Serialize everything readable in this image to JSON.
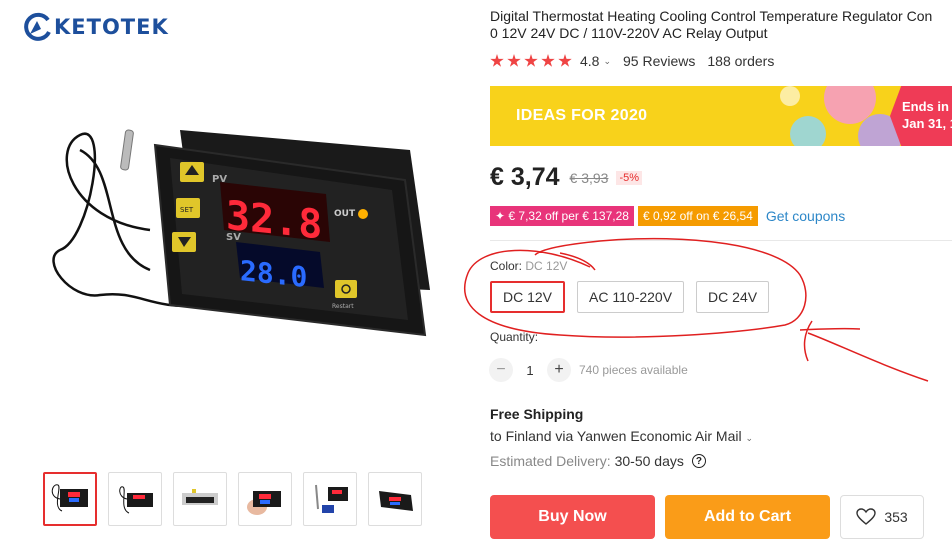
{
  "brand": {
    "logo_text": "KETOTEK"
  },
  "product": {
    "title_line1": "Digital Thermostat Heating Cooling Control Temperature Regulator Con",
    "title_line2": "0 12V 24V DC / 110V-220V AC Relay Output",
    "rating": "4.8",
    "reviews": "95 Reviews",
    "orders": "188 orders"
  },
  "device_display": {
    "pv_label": "PV",
    "sv_label": "SV",
    "set_label": "SET",
    "out_label": "OUT",
    "restart_label": "Restart",
    "pv_value": "32.8",
    "sv_value": "28.0"
  },
  "banner": {
    "text": "IDEAS FOR 2020",
    "ends_line1": "Ends in",
    "ends_line2": "Jan 31, 1"
  },
  "price": {
    "current": "€ 3,74",
    "original": "€ 3,93",
    "discount": "-5%"
  },
  "coupons": {
    "coupon1": "✦ € 7,32 off per € 137,28",
    "coupon2": "€ 0,92 off on € 26,54",
    "link": "Get coupons"
  },
  "color": {
    "label": "Color:",
    "selected_value": "DC 12V",
    "options": [
      "DC 12V",
      "AC 110-220V",
      "DC 24V"
    ]
  },
  "quantity": {
    "label": "Quantity:",
    "minus": "−",
    "value": "1",
    "plus": "+",
    "available": "740 pieces available"
  },
  "shipping": {
    "title": "Free Shipping",
    "destination": "to Finland via Yanwen Economic Air Mail",
    "delivery_label": "Estimated Delivery:",
    "delivery_days": "30-50 days",
    "help": "?"
  },
  "actions": {
    "buy_now": "Buy Now",
    "add_to_cart": "Add to Cart",
    "wishlist_count": "353"
  },
  "colors": {
    "accent_red": "#f44f4f",
    "accent_orange": "#fa9c18",
    "star_red": "#ef4444",
    "brand_blue": "#1d4f9c",
    "banner_yellow": "#f8d21b",
    "annotation_red": "#e02020"
  },
  "icons": [
    "logo-swirl-icon",
    "star-icon",
    "chevron-down-icon",
    "help-circle-icon",
    "heart-icon"
  ]
}
